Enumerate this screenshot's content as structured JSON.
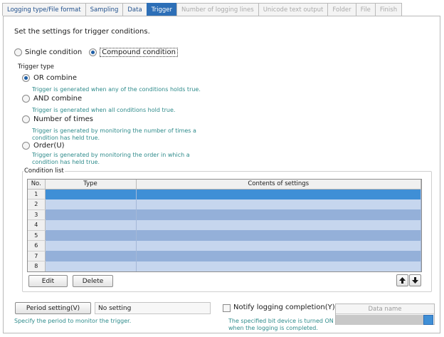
{
  "tabs": [
    {
      "label": "Logging type/File format",
      "state": "enabled"
    },
    {
      "label": "Sampling",
      "state": "enabled"
    },
    {
      "label": "Data",
      "state": "enabled"
    },
    {
      "label": "Trigger",
      "state": "active"
    },
    {
      "label": "Number of logging lines",
      "state": "disabled"
    },
    {
      "label": "Unicode text output",
      "state": "disabled"
    },
    {
      "label": "Folder",
      "state": "disabled"
    },
    {
      "label": "File",
      "state": "disabled"
    },
    {
      "label": "Finish",
      "state": "disabled"
    }
  ],
  "heading": "Set the settings for trigger conditions.",
  "condition_mode": {
    "single_label": "Single condition",
    "compound_label": "Compound condition",
    "selected": "compound"
  },
  "trigger_type": {
    "group_label": "Trigger type",
    "options": [
      {
        "label": "OR combine",
        "desc": "Trigger is generated when any of the conditions holds true.",
        "selected": true
      },
      {
        "label": "AND combine",
        "desc": "Trigger is generated when all conditions hold true.",
        "selected": false
      },
      {
        "label": "Number of times",
        "desc": "Trigger is generated by monitoring the number of times a condition has held true.",
        "selected": false
      },
      {
        "label": "Order(U)",
        "desc": "Trigger is generated by monitoring the order in which a condition has held true.",
        "selected": false
      }
    ]
  },
  "condition_list": {
    "group_label": "Condition list",
    "columns": [
      "No.",
      "Type",
      "Contents of settings"
    ],
    "rows": [
      "1",
      "2",
      "3",
      "4",
      "5",
      "6",
      "7",
      "8"
    ],
    "selected_row": 1,
    "edit_label": "Edit",
    "delete_label": "Delete"
  },
  "period": {
    "button_label": "Period setting(V)",
    "value": "No setting",
    "desc": "Specify the period to monitor the trigger."
  },
  "notify": {
    "label": "Notify logging completion(Y)",
    "checked": false,
    "desc_line1": "The specified bit device is turned ON",
    "desc_line2": "when the logging is completed."
  },
  "data_name": {
    "label": "Data name",
    "value": ""
  },
  "colors": {
    "active_tab": "#2d6fb7",
    "selected_row": "#3f8fd6",
    "row_light": "#c6d6ee",
    "row_dark": "#94b0d9",
    "desc_text": "#2e8b8b"
  }
}
